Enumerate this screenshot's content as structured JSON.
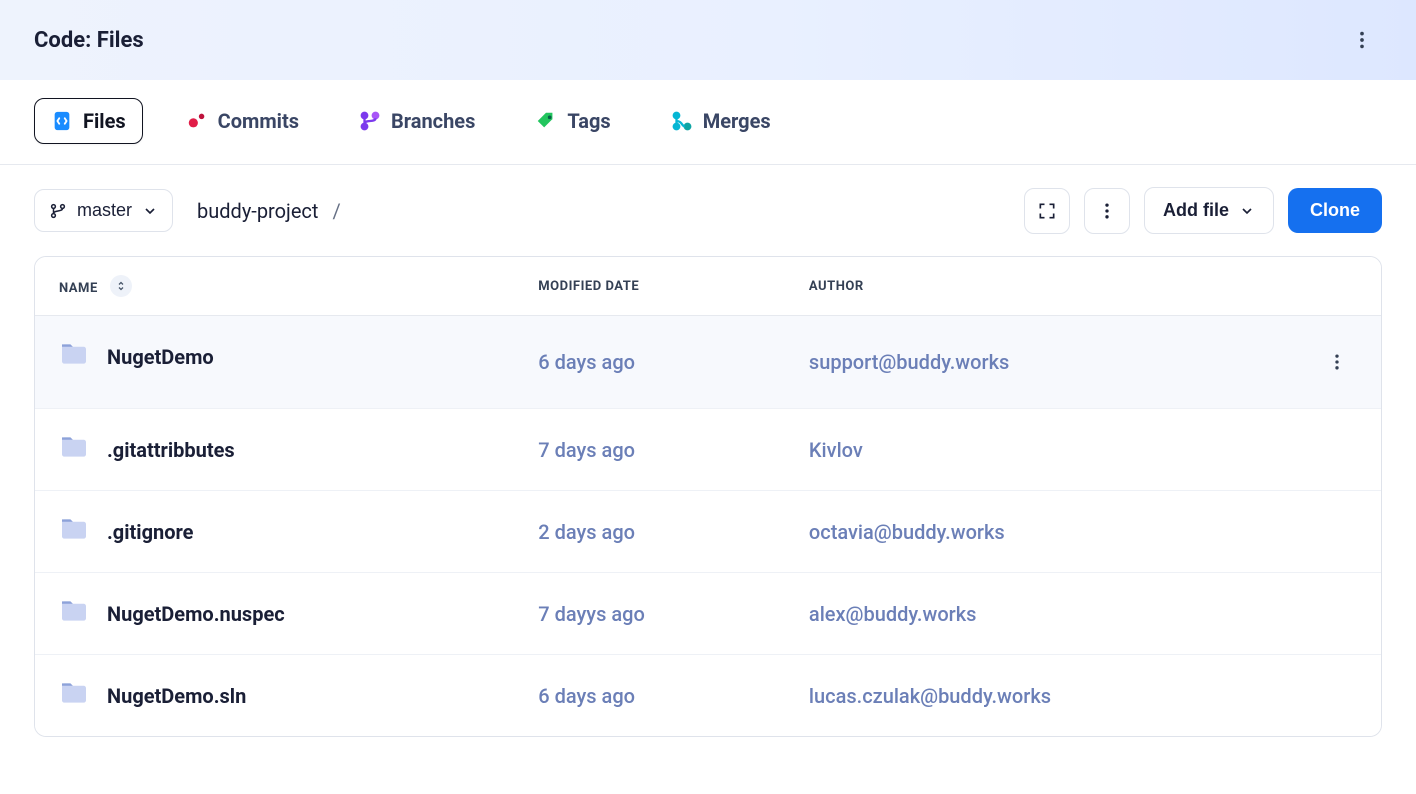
{
  "header": {
    "title": "Code: Files"
  },
  "tabs": {
    "files": "Files",
    "commits": "Commits",
    "branches": "Branches",
    "tags": "Tags",
    "merges": "Merges",
    "active": "files"
  },
  "branch": {
    "label": "master"
  },
  "breadcrumb": {
    "root": "buddy-project",
    "sep": "/"
  },
  "actions": {
    "add_file": "Add file",
    "clone": "Clone"
  },
  "columns": {
    "name": "NAME",
    "modified": "MODIFIED DATE",
    "author": "AUTHOR"
  },
  "rows": [
    {
      "name": "NugetDemo",
      "modified": "6 days ago",
      "author": "support@buddy.works",
      "selected": true
    },
    {
      "name": ".gitattribbutes",
      "modified": "7 days ago",
      "author": "Kivlov"
    },
    {
      "name": ".gitignore",
      "modified": "2 days ago",
      "author": "octavia@buddy.works"
    },
    {
      "name": "NugetDemo.nuspec",
      "modified": "7 dayys ago",
      "author": "alex@buddy.works"
    },
    {
      "name": "NugetDemo.sln",
      "modified": "6 days ago",
      "author": "lucas.czulak@buddy.works"
    }
  ]
}
